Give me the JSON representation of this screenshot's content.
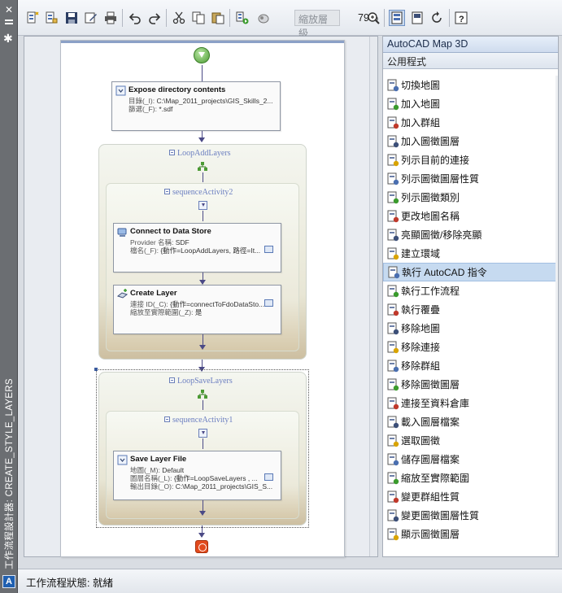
{
  "window": {
    "vertical_title": "工作流程設計器: CREATE_STYLE_LAYERS"
  },
  "toolbar": {
    "zoom_field_placeholder": "縮放層級",
    "zoom_percent": "79%"
  },
  "designer": {
    "expose": {
      "title": "Expose directory contents",
      "row1_label": "目錄(_I):",
      "row1_value": "C:\\Map_2011_projects\\GIS_Skills_2...",
      "row2_label": "篩選(_F):",
      "row2_value": "*.sdf"
    },
    "loop_add": {
      "label": "LoopAddLayers",
      "sequence_label": "sequenceActivity2",
      "connect": {
        "title": "Connect to Data Store",
        "row1_label": "Provider 名稱:",
        "row1_value": "SDF",
        "row2_label": "檔名(_F):",
        "row2_value": "{動作=LoopAddLayers, 路徑=It..."
      },
      "create": {
        "title": "Create Layer",
        "row1_label": "連接 ID(_C):",
        "row1_value": "{動作=connectToFdoDataSto...",
        "row2_label": "縮放至實際範圍(_Z):",
        "row2_value": "是"
      }
    },
    "loop_save": {
      "label": "LoopSaveLayers",
      "sequence_label": "sequenceActivity1",
      "save": {
        "title": "Save Layer File",
        "row1_label": "地圖(_M):",
        "row1_value": "Default",
        "row2_label": "圖層名稱(_L):",
        "row2_value": "{動作=LoopSaveLayers , ...",
        "row3_label": "輸出目錄(_O):",
        "row3_value": "C:\\Map_2011_projects\\GIS_S..."
      }
    }
  },
  "palette": {
    "header": "AutoCAD Map 3D",
    "category": "公用程式",
    "items": [
      {
        "label": "切換地圖",
        "icon": "switch-map-icon"
      },
      {
        "label": "加入地圖",
        "icon": "add-map-icon"
      },
      {
        "label": "加入群組",
        "icon": "add-group-icon"
      },
      {
        "label": "加入圖徵圖層",
        "icon": "add-feature-layer-icon"
      },
      {
        "label": "列示目前的連接",
        "icon": "list-connections-icon"
      },
      {
        "label": "列示圖徵圖層性質",
        "icon": "list-layer-properties-icon"
      },
      {
        "label": "列示圖徵類別",
        "icon": "list-feature-classes-icon"
      },
      {
        "label": "更改地圖名稱",
        "icon": "rename-map-icon"
      },
      {
        "label": "亮顯圖徵/移除亮顯",
        "icon": "highlight-icon"
      },
      {
        "label": "建立環域",
        "icon": "buffer-icon"
      },
      {
        "label": "執行 AutoCAD 指令",
        "icon": "autocad-command-icon"
      },
      {
        "label": "執行工作流程",
        "icon": "run-workflow-icon"
      },
      {
        "label": "執行覆疊",
        "icon": "overlay-icon"
      },
      {
        "label": "移除地圖",
        "icon": "remove-map-icon"
      },
      {
        "label": "移除連接",
        "icon": "remove-connection-icon"
      },
      {
        "label": "移除群組",
        "icon": "remove-group-icon"
      },
      {
        "label": "移除圖徵圖層",
        "icon": "remove-feature-layer-icon"
      },
      {
        "label": "連接至資料倉庫",
        "icon": "connect-data-store-icon"
      },
      {
        "label": "載入圖層檔案",
        "icon": "load-layer-file-icon"
      },
      {
        "label": "選取圖徵",
        "icon": "select-features-icon"
      },
      {
        "label": "儲存圖層檔案",
        "icon": "save-layer-file-icon"
      },
      {
        "label": "縮放至實際範圍",
        "icon": "zoom-extents-icon"
      },
      {
        "label": "變更群組性質",
        "icon": "group-properties-icon"
      },
      {
        "label": "變更圖徵圖層性質",
        "icon": "layer-properties-icon"
      },
      {
        "label": "顯示圖徵圖層",
        "icon": "show-layer-icon"
      }
    ],
    "selected_index": 10
  },
  "status": {
    "text": "工作流程狀態: 就緒"
  }
}
